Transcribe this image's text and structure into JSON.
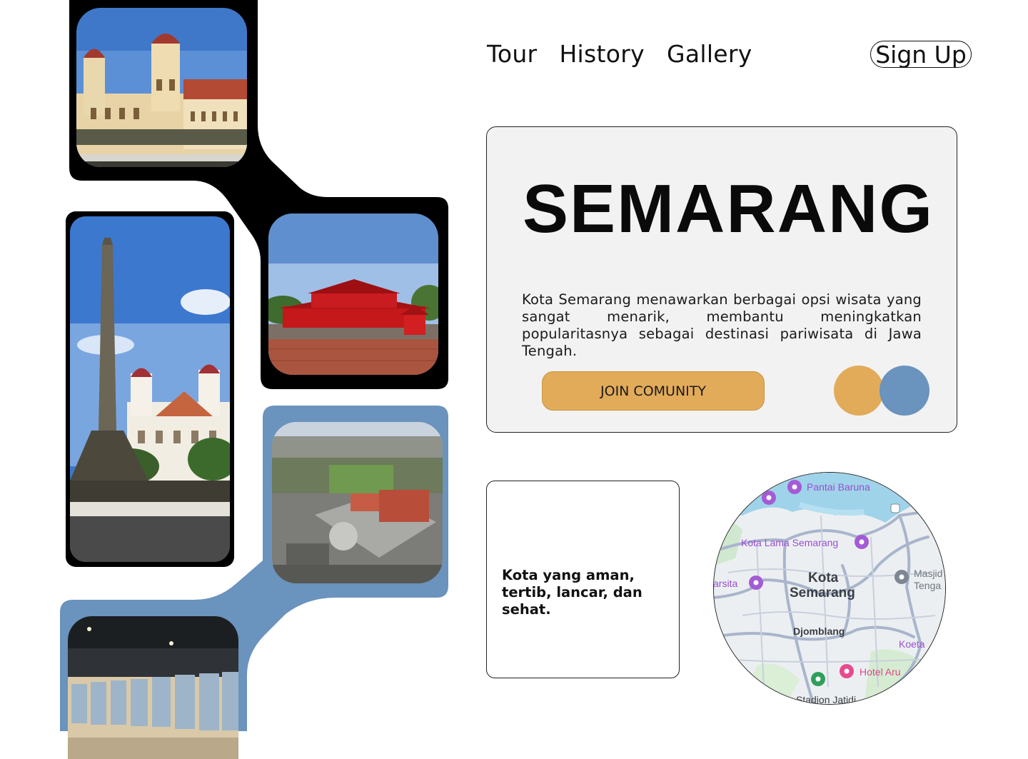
{
  "nav": {
    "items": [
      "Tour",
      "History",
      "Gallery"
    ],
    "signup_label": "Sign Up"
  },
  "hero": {
    "title": "SEMARANG",
    "description": "Kota Semarang menawarkan berbagai opsi wisata yang sangat menarik, membantu meningkatkan popularitasnya sebagai destinasi pariwisata di Jawa Tengah.",
    "cta_label": "JOIN COMUNITY"
  },
  "tagline": "Kota yang aman, tertib, lancar, dan sehat.",
  "map": {
    "labels": {
      "pantai": "Pantai Baruna",
      "kota_lama": "Kota Lama Semarang",
      "kota_line1": "Kota",
      "kota_line2": "Semarang",
      "masjid": "Masjid",
      "tengah": "Tenga",
      "varsita": "arsita",
      "djomblang": "Djomblang",
      "koeta": "Koeta",
      "hotel": "Hotel Aru",
      "stadion": "Stadion Jatidi"
    }
  },
  "colors": {
    "accent_gold": "#e2ab5a",
    "accent_blue": "#6a93bd",
    "frame_black": "#000000",
    "card_bg": "#f2f2f2"
  }
}
